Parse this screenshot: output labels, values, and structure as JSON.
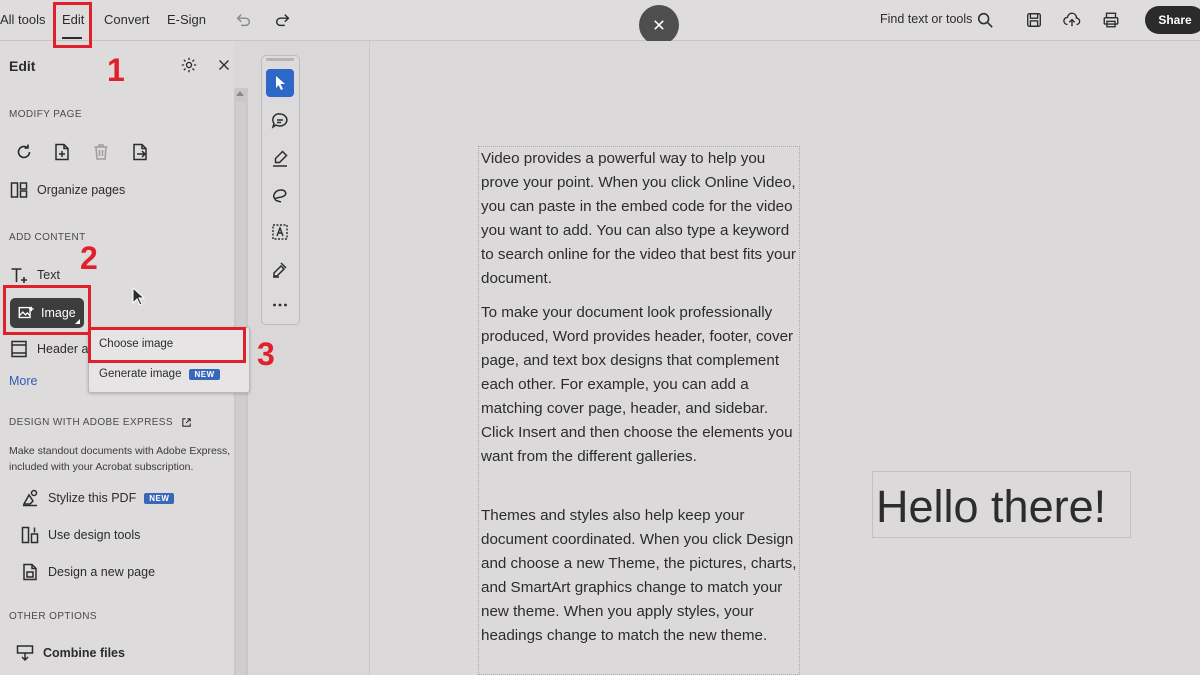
{
  "topbar": {
    "all_tools": "All tools",
    "edit": "Edit",
    "convert": "Convert",
    "esign": "E-Sign",
    "find_text": "Find text or tools",
    "share": "Share"
  },
  "panel": {
    "title": "Edit",
    "modify_page_heading": "MODIFY PAGE",
    "organize_pages": "Organize pages",
    "add_content_heading": "ADD CONTENT",
    "text": "Text",
    "image": "Image",
    "header": "Header a",
    "more": "More",
    "design_heading": "DESIGN WITH ADOBE EXPRESS",
    "design_desc_1": "Make standout documents with Adobe Express,",
    "design_desc_2": "included with your Acrobat subscription.",
    "stylize_pdf": "Stylize this PDF",
    "new_badge": "NEW",
    "use_design_tools": "Use design tools",
    "design_new_page": "Design a new page",
    "other_options_heading": "OTHER OPTIONS",
    "combine_files": "Combine files"
  },
  "popup": {
    "choose_image": "Choose image",
    "generate_image": "Generate image",
    "new_badge": "NEW"
  },
  "annotations": {
    "step1": "1",
    "step2": "2",
    "step3": "3",
    "color": "#e0202a"
  },
  "document": {
    "para1": "Video provides a powerful way to help you prove your point. When you click Online Video, you can paste in the embed code for the video you want to add. You can also type a keyword to search online for the video that best fits your document.",
    "para2": "To make your document look professionally produced, Word provides header, footer, cover page, and text box designs that complement each other. For example, you can add a matching cover page, header, and sidebar. Click Insert and then choose the elements you want from the different galleries.",
    "para3": "Themes and styles also help keep your document coordinated. When you click Design and choose a new Theme, the pictures, charts, and SmartArt graphics change to match your new theme. When you apply styles, your headings change to match the new theme.",
    "hello": "Hello there!"
  },
  "icons": {
    "topbar": [
      "undo-icon",
      "redo-icon",
      "search-icon",
      "save-icon",
      "cloud-upload-icon",
      "print-icon",
      "close-icon"
    ],
    "tools": [
      "select-cursor-icon",
      "comment-icon",
      "highlight-pen-icon",
      "lasso-icon",
      "text-select-icon",
      "fill-sign-icon",
      "more-icon"
    ]
  }
}
